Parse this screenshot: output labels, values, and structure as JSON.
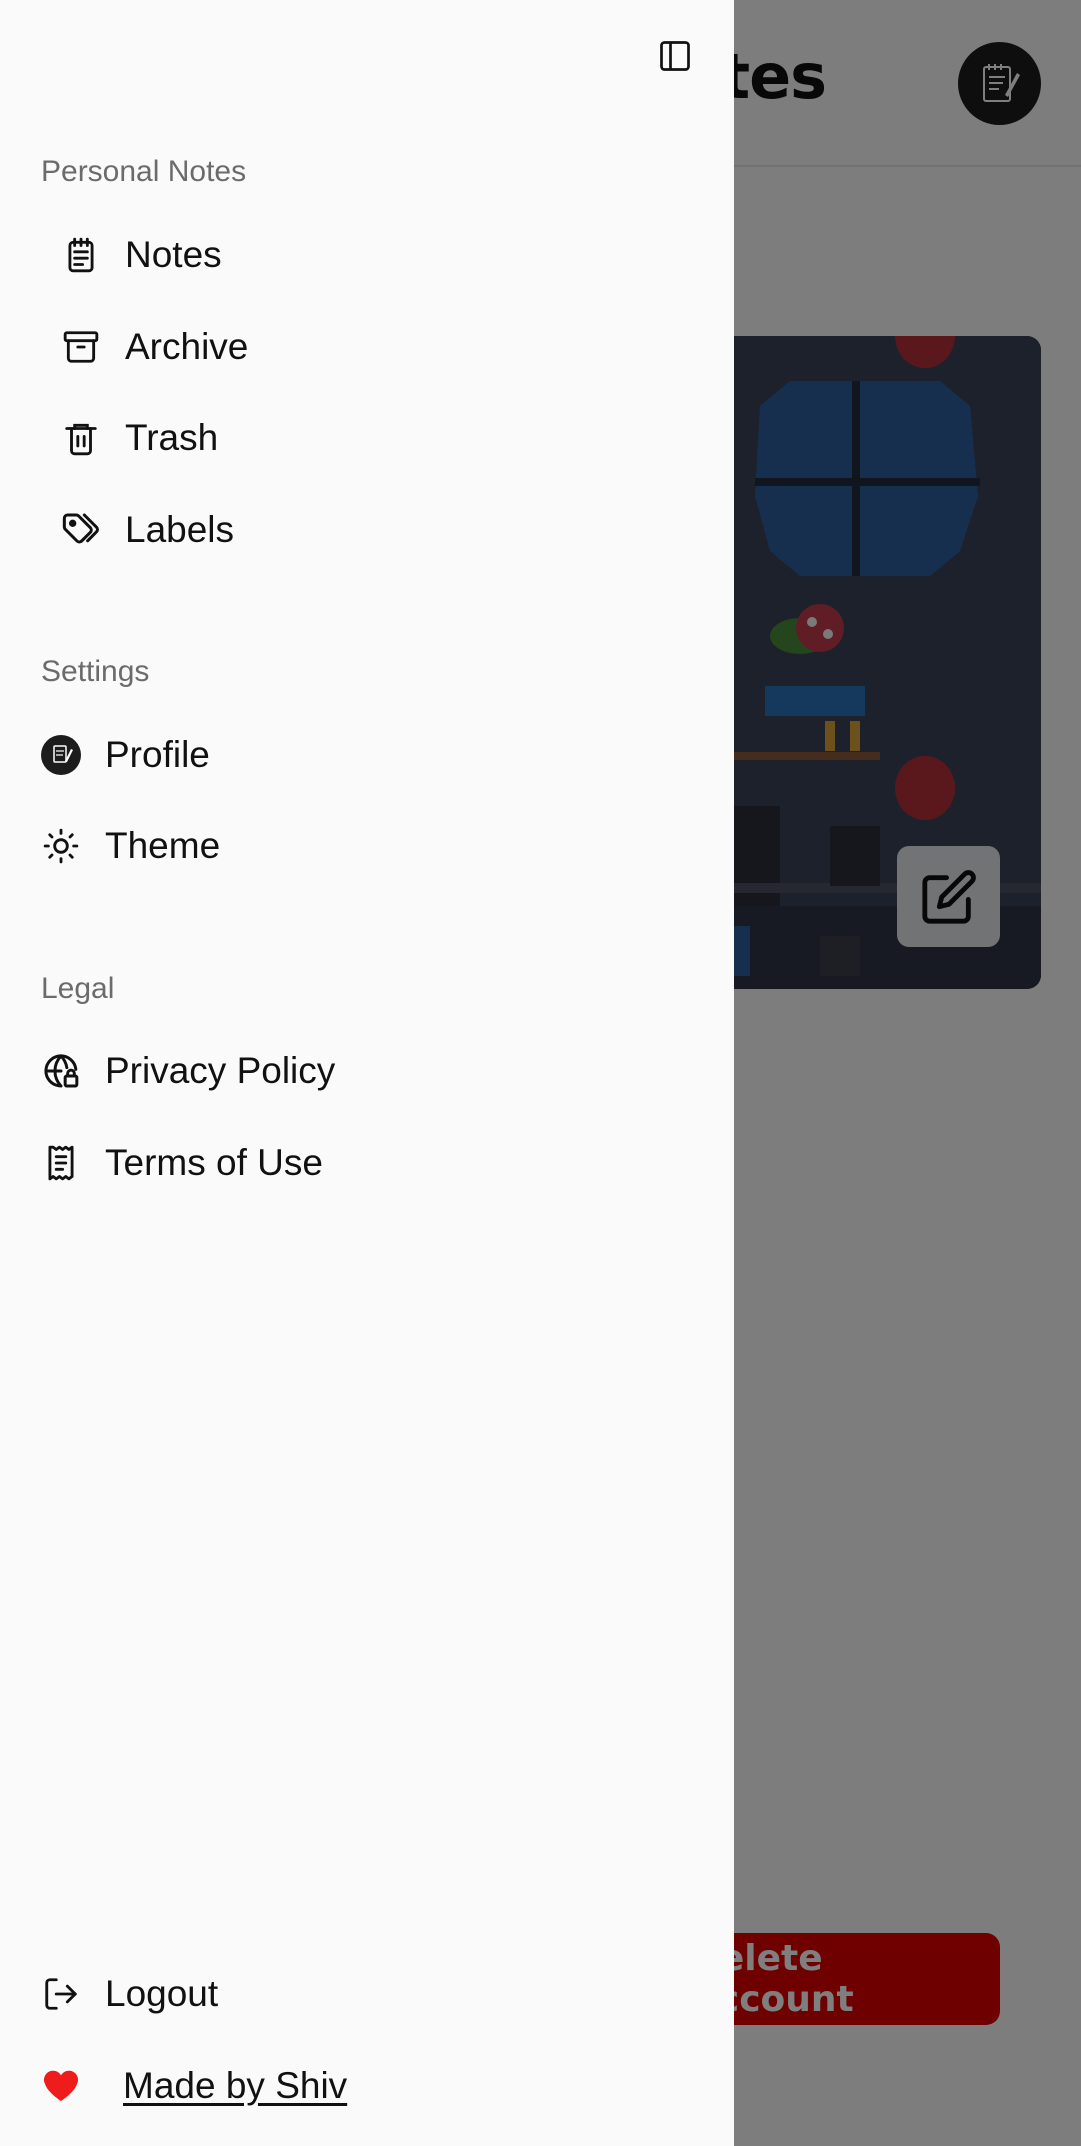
{
  "background": {
    "page_title": "Notes",
    "delete_button": "Delete Account"
  },
  "drawer": {
    "sections": [
      {
        "title": "Personal Notes",
        "items": [
          {
            "label": "Notes",
            "icon": "notepad-icon"
          },
          {
            "label": "Archive",
            "icon": "archive-icon"
          },
          {
            "label": "Trash",
            "icon": "trash-icon"
          },
          {
            "label": "Labels",
            "icon": "tags-icon"
          }
        ]
      },
      {
        "title": "Settings",
        "items": [
          {
            "label": "Profile",
            "icon": "avatar-icon"
          },
          {
            "label": "Theme",
            "icon": "sun-icon"
          }
        ]
      },
      {
        "title": "Legal",
        "items": [
          {
            "label": "Privacy Policy",
            "icon": "globe-lock-icon"
          },
          {
            "label": "Terms of Use",
            "icon": "receipt-icon"
          }
        ]
      }
    ],
    "footer": {
      "logout": "Logout",
      "made_by": "Made by Shiv"
    }
  },
  "colors": {
    "drawer_bg": "#fafafa",
    "overlay": "rgba(0,0,0,0.5)",
    "heart": "#ef1c1c",
    "delete_button": "#dc0000"
  }
}
